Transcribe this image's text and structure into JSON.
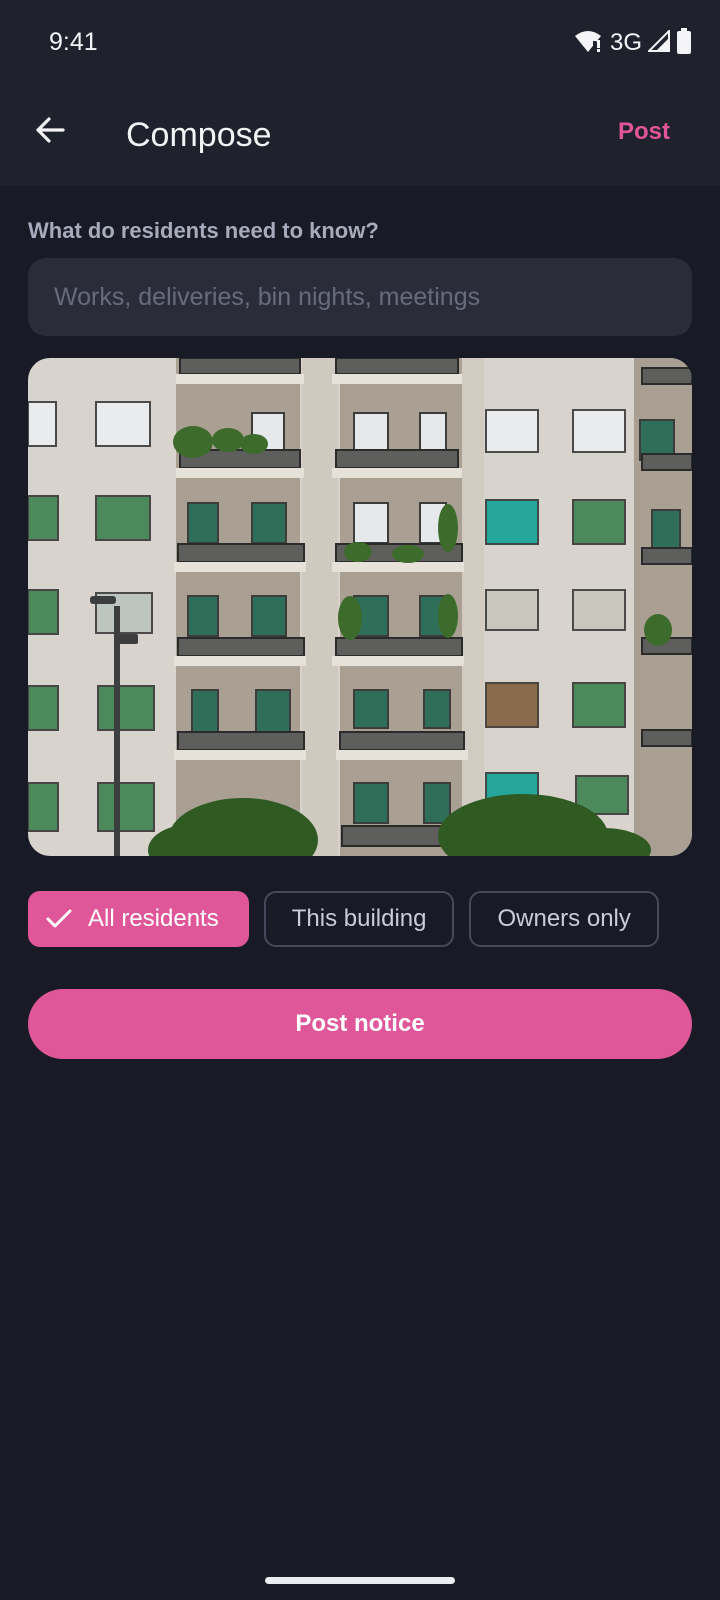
{
  "status_bar": {
    "time": "9:41",
    "network": "3G",
    "icons": [
      "wifi-icon",
      "signal-icon",
      "battery-icon"
    ]
  },
  "app_bar": {
    "back_icon": "arrow-left-icon",
    "title": "Compose",
    "action_label": "Post"
  },
  "form": {
    "question_label": "What do residents need to know?",
    "input_value": "",
    "input_placeholder": "Works, deliveries, bin nights, meetings",
    "photo_alt": "Apartment building facade with balconies",
    "audience_chips": [
      {
        "label": "All residents",
        "selected": true
      },
      {
        "label": "This building",
        "selected": false
      },
      {
        "label": "Owners only",
        "selected": false
      }
    ],
    "submit_label": "Post notice"
  },
  "colors": {
    "accent": "#e05799",
    "background": "#181a25",
    "surface": "#1f212c",
    "input": "#2a2d39"
  }
}
